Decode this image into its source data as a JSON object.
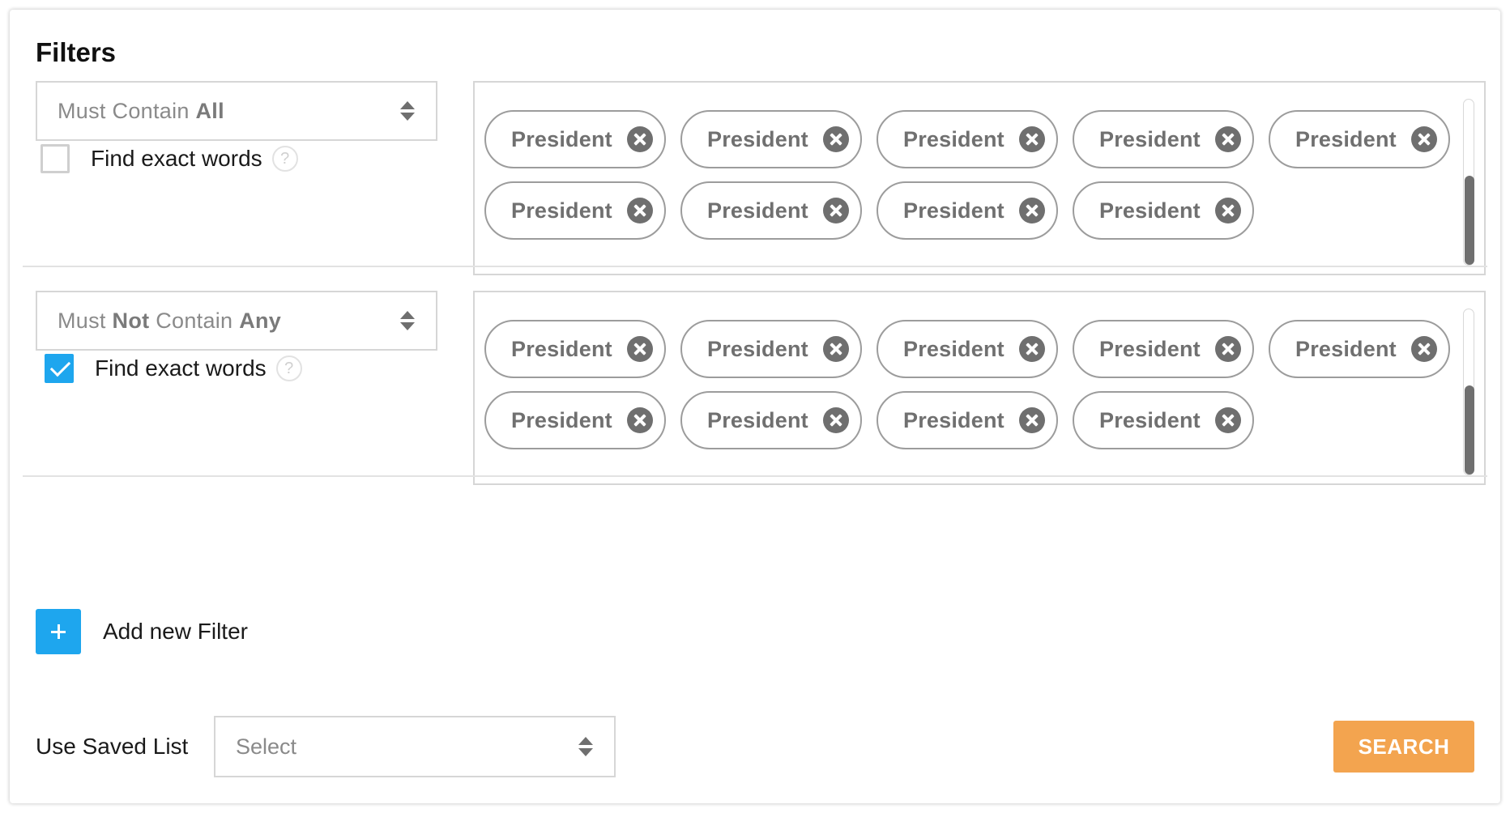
{
  "title": "Filters",
  "filters": [
    {
      "mode_prefix": "Must ",
      "mode_bold1": "",
      "mode_mid": "Contain ",
      "mode_bold2": "All",
      "exact_label": "Find exact words",
      "exact_checked": false,
      "help_symbol": "?",
      "tags": [
        "President",
        "President",
        "President",
        "President",
        "President",
        "President",
        "President",
        "President",
        "President"
      ]
    },
    {
      "mode_prefix": "Must ",
      "mode_bold1": "Not",
      "mode_mid": " Contain ",
      "mode_bold2": "Any",
      "exact_label": "Find exact words",
      "exact_checked": true,
      "help_symbol": "?",
      "tags": [
        "President",
        "President",
        "President",
        "President",
        "President",
        "President",
        "President",
        "President",
        "President"
      ]
    }
  ],
  "add_filter_label": "Add new Filter",
  "saved_list": {
    "label": "Use Saved List",
    "placeholder": "Select"
  },
  "search_label": "SEARCH",
  "colors": {
    "accent_blue": "#1ea6ee",
    "search_orange": "#f3a44f",
    "tag_border": "#9c9c9c",
    "tag_text": "#707070"
  }
}
